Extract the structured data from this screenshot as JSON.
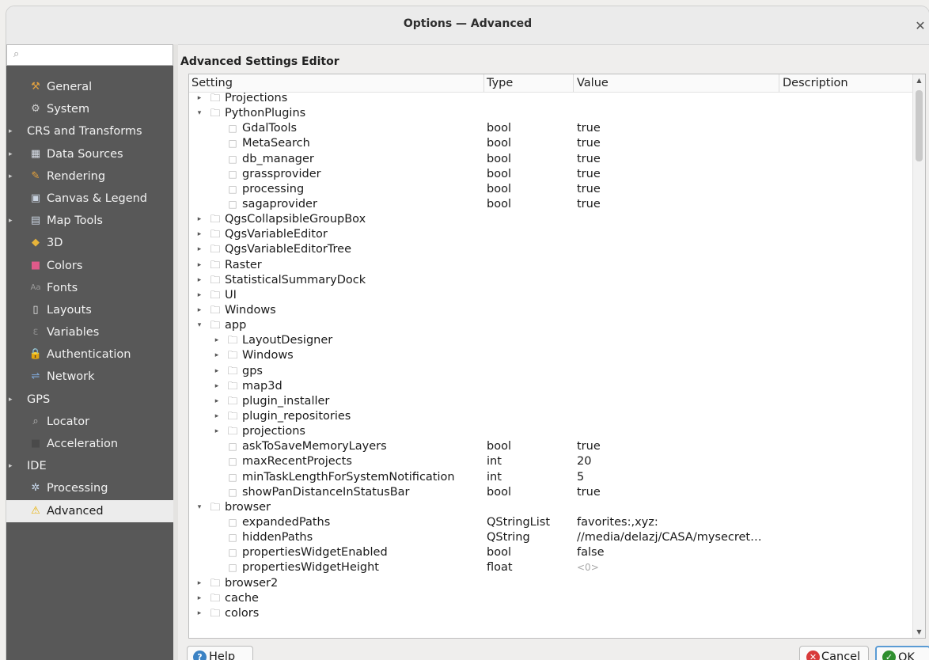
{
  "window": {
    "title": "Options — Advanced"
  },
  "sidebar": {
    "search_placeholder": "",
    "items": [
      {
        "label": "General",
        "icon": "⚒",
        "icon_name": "general-tools-icon",
        "arrow": "",
        "selected": false,
        "icon_color": "#e0a040"
      },
      {
        "label": "System",
        "icon": "⚙",
        "icon_name": "system-gear-icon",
        "arrow": "",
        "selected": false,
        "icon_color": "#cfcfcf"
      },
      {
        "label": "CRS and Transforms",
        "icon": "",
        "icon_name": "",
        "arrow": "▸",
        "selected": false,
        "icon_color": ""
      },
      {
        "label": "Data Sources",
        "icon": "▦",
        "icon_name": "data-sources-table-icon",
        "arrow": "▸",
        "selected": false,
        "icon_color": "#d7dce6"
      },
      {
        "label": "Rendering",
        "icon": "✎",
        "icon_name": "rendering-brush-icon",
        "arrow": "▸",
        "selected": false,
        "icon_color": "#e8a33a"
      },
      {
        "label": "Canvas & Legend",
        "icon": "▣",
        "icon_name": "canvas-legend-icon",
        "arrow": "",
        "selected": false,
        "icon_color": "#c9d3e0"
      },
      {
        "label": "Map Tools",
        "icon": "▤",
        "icon_name": "map-tools-icon",
        "arrow": "▸",
        "selected": false,
        "icon_color": "#c9d3e0"
      },
      {
        "label": "3D",
        "icon": "◆",
        "icon_name": "3d-cube-icon",
        "arrow": "",
        "selected": false,
        "icon_color": "#e7b43a"
      },
      {
        "label": "Colors",
        "icon": "■",
        "icon_name": "colors-palette-icon",
        "arrow": "",
        "selected": false,
        "icon_color": "#e05a8a"
      },
      {
        "label": "Fonts",
        "icon": "Aa",
        "icon_name": "fonts-icon",
        "arrow": "",
        "selected": false,
        "icon_color": "#9a9a9a"
      },
      {
        "label": "Layouts",
        "icon": "▯",
        "icon_name": "layouts-icon",
        "arrow": "",
        "selected": false,
        "icon_color": "#e8e8e8"
      },
      {
        "label": "Variables",
        "icon": "ε",
        "icon_name": "variables-epsilon-icon",
        "arrow": "",
        "selected": false,
        "icon_color": "#8a8a8a"
      },
      {
        "label": "Authentication",
        "icon": "🔒",
        "icon_name": "authentication-lock-icon",
        "arrow": "",
        "selected": false,
        "icon_color": "#f0c030"
      },
      {
        "label": "Network",
        "icon": "⇌",
        "icon_name": "network-icon",
        "arrow": "",
        "selected": false,
        "icon_color": "#7fa8d8"
      },
      {
        "label": "GPS",
        "icon": "",
        "icon_name": "",
        "arrow": "▸",
        "selected": false,
        "icon_color": ""
      },
      {
        "label": "Locator",
        "icon": "⌕",
        "icon_name": "locator-search-icon",
        "arrow": "",
        "selected": false,
        "icon_color": "#bdbdbd"
      },
      {
        "label": "Acceleration",
        "icon": "■",
        "icon_name": "acceleration-icon",
        "arrow": "",
        "selected": false,
        "icon_color": "#4a4a4a"
      },
      {
        "label": "IDE",
        "icon": "",
        "icon_name": "",
        "arrow": "▸",
        "selected": false,
        "icon_color": ""
      },
      {
        "label": "Processing",
        "icon": "✲",
        "icon_name": "processing-gear-icon",
        "arrow": "",
        "selected": false,
        "icon_color": "#c8d8ec"
      },
      {
        "label": "Advanced",
        "icon": "⚠",
        "icon_name": "advanced-warning-icon",
        "arrow": "",
        "selected": true,
        "icon_color": "#e8b000"
      }
    ]
  },
  "editor": {
    "title": "Advanced Settings Editor",
    "columns": {
      "setting": "Setting",
      "type": "Type",
      "value": "Value",
      "description": "Description"
    },
    "rows": [
      {
        "level": 0,
        "kind": "group",
        "expanded": false,
        "name": "Projections"
      },
      {
        "level": 0,
        "kind": "group",
        "expanded": true,
        "name": "PythonPlugins"
      },
      {
        "level": 1,
        "kind": "leaf",
        "name": "GdalTools",
        "type": "bool",
        "value": "true"
      },
      {
        "level": 1,
        "kind": "leaf",
        "name": "MetaSearch",
        "type": "bool",
        "value": "true"
      },
      {
        "level": 1,
        "kind": "leaf",
        "name": "db_manager",
        "type": "bool",
        "value": "true"
      },
      {
        "level": 1,
        "kind": "leaf",
        "name": "grassprovider",
        "type": "bool",
        "value": "true"
      },
      {
        "level": 1,
        "kind": "leaf",
        "name": "processing",
        "type": "bool",
        "value": "true"
      },
      {
        "level": 1,
        "kind": "leaf",
        "name": "sagaprovider",
        "type": "bool",
        "value": "true"
      },
      {
        "level": 0,
        "kind": "group",
        "expanded": false,
        "name": "QgsCollapsibleGroupBox"
      },
      {
        "level": 0,
        "kind": "group",
        "expanded": false,
        "name": "QgsVariableEditor"
      },
      {
        "level": 0,
        "kind": "group",
        "expanded": false,
        "name": "QgsVariableEditorTree"
      },
      {
        "level": 0,
        "kind": "group",
        "expanded": false,
        "name": "Raster"
      },
      {
        "level": 0,
        "kind": "group",
        "expanded": false,
        "name": "StatisticalSummaryDock"
      },
      {
        "level": 0,
        "kind": "group",
        "expanded": false,
        "name": "UI"
      },
      {
        "level": 0,
        "kind": "group",
        "expanded": false,
        "name": "Windows"
      },
      {
        "level": 0,
        "kind": "group",
        "expanded": true,
        "name": "app"
      },
      {
        "level": 1,
        "kind": "group",
        "expanded": false,
        "name": "LayoutDesigner"
      },
      {
        "level": 1,
        "kind": "group",
        "expanded": false,
        "name": "Windows"
      },
      {
        "level": 1,
        "kind": "group",
        "expanded": false,
        "name": "gps"
      },
      {
        "level": 1,
        "kind": "group",
        "expanded": false,
        "name": "map3d"
      },
      {
        "level": 1,
        "kind": "group",
        "expanded": false,
        "name": "plugin_installer"
      },
      {
        "level": 1,
        "kind": "group",
        "expanded": false,
        "name": "plugin_repositories"
      },
      {
        "level": 1,
        "kind": "group",
        "expanded": false,
        "name": "projections"
      },
      {
        "level": 1,
        "kind": "leaf",
        "name": "askToSaveMemoryLayers",
        "type": "bool",
        "value": "true"
      },
      {
        "level": 1,
        "kind": "leaf",
        "name": "maxRecentProjects",
        "type": "int",
        "value": "20"
      },
      {
        "level": 1,
        "kind": "leaf",
        "name": "minTaskLengthForSystemNotification",
        "type": "int",
        "value": "5"
      },
      {
        "level": 1,
        "kind": "leaf",
        "name": "showPanDistanceInStatusBar",
        "type": "bool",
        "value": "true"
      },
      {
        "level": 0,
        "kind": "group",
        "expanded": true,
        "name": "browser"
      },
      {
        "level": 1,
        "kind": "leaf",
        "name": "expandedPaths",
        "type": "QStringList",
        "value": "favorites:,xyz:"
      },
      {
        "level": 1,
        "kind": "leaf",
        "name": "hiddenPaths",
        "type": "QString",
        "value": "//media/delazj/CASA/mysecret…"
      },
      {
        "level": 1,
        "kind": "leaf",
        "name": "propertiesWidgetEnabled",
        "type": "bool",
        "value": "false"
      },
      {
        "level": 1,
        "kind": "leaf",
        "name": "propertiesWidgetHeight",
        "type": "float",
        "value": "<0>",
        "dim": true
      },
      {
        "level": 0,
        "kind": "group",
        "expanded": false,
        "name": "browser2"
      },
      {
        "level": 0,
        "kind": "group",
        "expanded": false,
        "name": "cache"
      },
      {
        "level": 0,
        "kind": "group",
        "expanded": false,
        "name": "colors"
      }
    ]
  },
  "buttons": {
    "help": {
      "label": "Help",
      "icon": "?"
    },
    "cancel": {
      "label_accel": "C",
      "label_rest": "ancel",
      "icon": "✕"
    },
    "ok": {
      "label_accel": "O",
      "label_rest": "K",
      "icon": "✓"
    }
  }
}
